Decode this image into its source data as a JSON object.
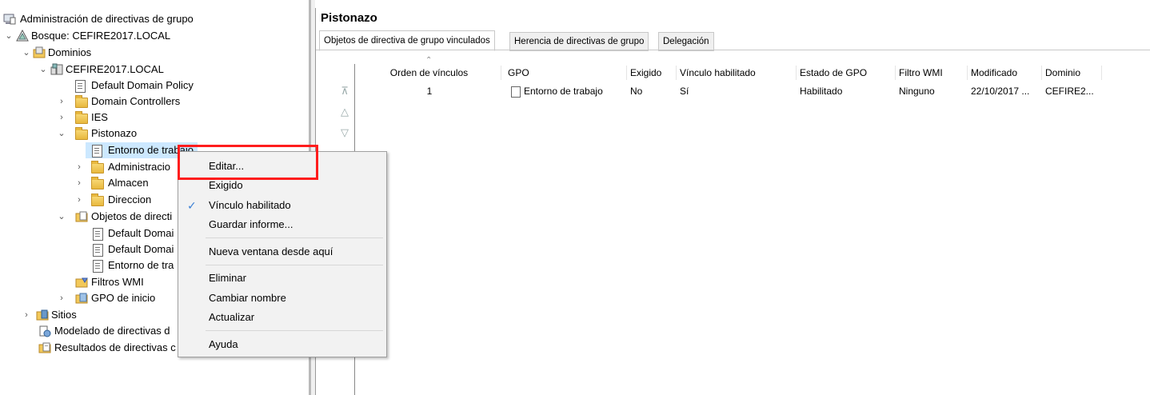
{
  "tree": {
    "items": [
      {
        "label": "Administración de directivas de grupo",
        "icon": "gpmc-icon",
        "arrow": ""
      },
      {
        "label": "Bosque: CEFIRE2017.LOCAL",
        "icon": "forest-icon",
        "arrow": "v"
      },
      {
        "label": "Dominios",
        "icon": "domains-icon",
        "arrow": "v"
      },
      {
        "label": "CEFIRE2017.LOCAL",
        "icon": "domain-icon",
        "arrow": "v"
      },
      {
        "label": "Default Domain Policy",
        "icon": "gpo-link-icon",
        "arrow": ""
      },
      {
        "label": "Domain Controllers",
        "icon": "ou-folder-icon",
        "arrow": ">"
      },
      {
        "label": "IES",
        "icon": "ou-folder-icon",
        "arrow": ">"
      },
      {
        "label": "Pistonazo",
        "icon": "ou-folder-icon",
        "arrow": "v"
      },
      {
        "label": "Entorno de trabajo",
        "icon": "gpo-link-icon",
        "arrow": ""
      },
      {
        "label": "Administracio",
        "icon": "ou-folder-icon",
        "arrow": ">"
      },
      {
        "label": "Almacen",
        "icon": "ou-folder-icon",
        "arrow": ">"
      },
      {
        "label": "Direccion",
        "icon": "ou-folder-icon",
        "arrow": ">"
      },
      {
        "label": "Objetos de directi",
        "icon": "gpo-folder-icon",
        "arrow": "v"
      },
      {
        "label": "Default Domai",
        "icon": "gpo-icon",
        "arrow": ""
      },
      {
        "label": "Default Domai",
        "icon": "gpo-icon",
        "arrow": ""
      },
      {
        "label": "Entorno de tra",
        "icon": "gpo-icon",
        "arrow": ""
      },
      {
        "label": "Filtros WMI",
        "icon": "wmi-folder-icon",
        "arrow": ""
      },
      {
        "label": "GPO de inicio",
        "icon": "starter-gpo-icon",
        "arrow": ">"
      },
      {
        "label": "Sitios",
        "icon": "sites-icon",
        "arrow": ">"
      },
      {
        "label": "Modelado de directivas d",
        "icon": "modeling-icon",
        "arrow": ""
      },
      {
        "label": "Resultados de directivas c",
        "icon": "results-icon",
        "arrow": ""
      }
    ]
  },
  "pane": {
    "title": "Pistonazo",
    "tabs": [
      "Objetos de directiva de grupo vinculados",
      "Herencia de directivas de grupo",
      "Delegación"
    ],
    "columns": [
      "Orden de vínculos",
      "GPO",
      "Exigido",
      "Vínculo habilitado",
      "Estado de GPO",
      "Filtro WMI",
      "Modificado",
      "Dominio"
    ],
    "rows": [
      [
        "1",
        "Entorno de trabajo",
        "No",
        "Sí",
        "Habilitado",
        "Ninguno",
        "22/10/2017 ...",
        "CEFIRE2..."
      ]
    ]
  },
  "menu": {
    "items": [
      "Editar...",
      "Exigido",
      "Vínculo habilitado",
      "Guardar informe...",
      "Nueva ventana desde aquí",
      "Eliminar",
      "Cambiar nombre",
      "Actualizar",
      "Ayuda"
    ],
    "checked_item": "Vínculo habilitado"
  },
  "colors": {
    "highlight_box": "#ff1d1d",
    "selection": "#cce8ff",
    "check": "#3a7fd5"
  }
}
